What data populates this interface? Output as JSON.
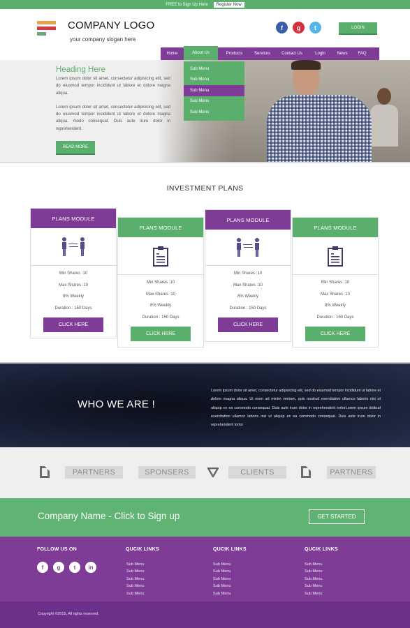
{
  "topbar": {
    "free_text": "FREE to Sign Up Here",
    "register_label": "Register Now"
  },
  "header": {
    "logo_title": "COMPANY LOGO",
    "slogan": "your company slogan here",
    "social": [
      {
        "icon": "facebook-icon",
        "glyph": "f"
      },
      {
        "icon": "google-plus-icon",
        "glyph": "g"
      },
      {
        "icon": "twitter-icon",
        "glyph": "t"
      }
    ],
    "login_label": "LOGIN"
  },
  "nav": {
    "items": [
      "Home",
      "About Us",
      "Products",
      "Services",
      "Contact Us",
      "Login",
      "News",
      "FAQ"
    ],
    "active": "About Us",
    "submenu": [
      "Sub Menu",
      "Sub Menu",
      "Sub Menu",
      "Sub Menu",
      "Sub Menu"
    ],
    "submenu_highlighted_index": 2
  },
  "hero": {
    "heading": "Heading Here",
    "paragraphs": [
      "Lorem ipsum dolor sit amet, consectetur adipisicing elit, sed do eiusmod tempor incididunt ut labore et dolore magna aliqua.",
      "Lorem ipsum dolor sit amet, consectetur adipisicing elit, sed do eiusmod tempor incididunt ut labore et dolore magna aliqua. modo consequat. Duis aute irure dolor in reprehenderit."
    ],
    "button_label": "READ MORE"
  },
  "investment": {
    "title": "INVESTMENT PLANS",
    "plans": [
      {
        "title": "PLANS MODULE",
        "icon": "people-exchange-icon",
        "theme": "purple",
        "stats": [
          "Min Shares :10",
          "Max Shares :10",
          "8% Weekly",
          "Duration : 150 Days"
        ],
        "button": "CLICK HERE"
      },
      {
        "title": "PLANS  MODULE",
        "icon": "clipboard-icon",
        "theme": "green",
        "stats": [
          "Min Shares :10",
          "Max Shares :10",
          "8% Weekly",
          "Duration : 150 Days"
        ],
        "button": "CLICK HERE"
      },
      {
        "title": "PLANS MODULE",
        "icon": "people-exchange-icon",
        "theme": "purple",
        "stats": [
          "Min Shares :10",
          "Max Shares :10",
          "8% Weekly",
          "Duration : 150 Days"
        ],
        "button": "CLICK HERE"
      },
      {
        "title": "PLANS MODULE",
        "icon": "clipboard-icon",
        "theme": "green",
        "stats": [
          "Min Shares :10",
          "Max Shares :10",
          "8% Weekly",
          "Duration : 150 Days"
        ],
        "button": "CLICK HERE"
      }
    ]
  },
  "who": {
    "title": "WHO WE ARE !",
    "text": "Lorem ipsum dolor sit amet, consectetur adipisicing elit, sed do eiusmod tempor incididunt ut labore et dolore magna aliqua. Ut enim ad minim veniam, quis nostrud exercitation ullamco laboris nisi ut aliquip ex ea commodo consequat. Duis aute irure dolor in reprehenderit tortorLorem ipsum doltrud exercitation ullamco laboris nisi ut aliquip ex ea commodo consequat. Duis aute irure dolor in reprehenderit tortor"
  },
  "partners": {
    "items": [
      {
        "icon": "document-icon",
        "label": "PARTNERS"
      },
      {
        "icon": null,
        "label": "SPONSERS"
      },
      {
        "icon": "triangle-logo-icon",
        "label": "CLIENTS"
      },
      {
        "icon": "document-icon",
        "label": "PARTNERS"
      }
    ]
  },
  "cta": {
    "text": "Company Name -  Click to Sign up",
    "button_label": "GET STARTED"
  },
  "footer": {
    "follow_title": "FOLLOW US ON",
    "social": [
      {
        "icon": "facebook-icon",
        "glyph": "f"
      },
      {
        "icon": "google-plus-icon",
        "glyph": "g"
      },
      {
        "icon": "twitter-icon",
        "glyph": "t"
      },
      {
        "icon": "linkedin-icon",
        "glyph": "in"
      }
    ],
    "columns": [
      {
        "title": "QUCIK LINKS",
        "links": [
          "Sub Menu",
          "Sub Menu",
          "Sub Menu",
          "Sub Menu",
          "Sub Menu"
        ]
      },
      {
        "title": "QUCIK LINKS",
        "links": [
          "Sub Menu",
          "Sub Menu",
          "Sub Menu",
          "Sub Menu",
          "Sub Menu"
        ]
      },
      {
        "title": "QUCIK LINKS",
        "links": [
          "Sub Menu",
          "Sub Menu",
          "Sub Menu",
          "Sub Menu",
          "Sub Menu"
        ]
      }
    ],
    "copyright": "Copyright ©2015, All rights reserved."
  },
  "colors": {
    "green": "#5aaf6d",
    "purple": "#7e3c96",
    "dark_purple": "#6c2f8a",
    "navy": "#141a2c"
  }
}
